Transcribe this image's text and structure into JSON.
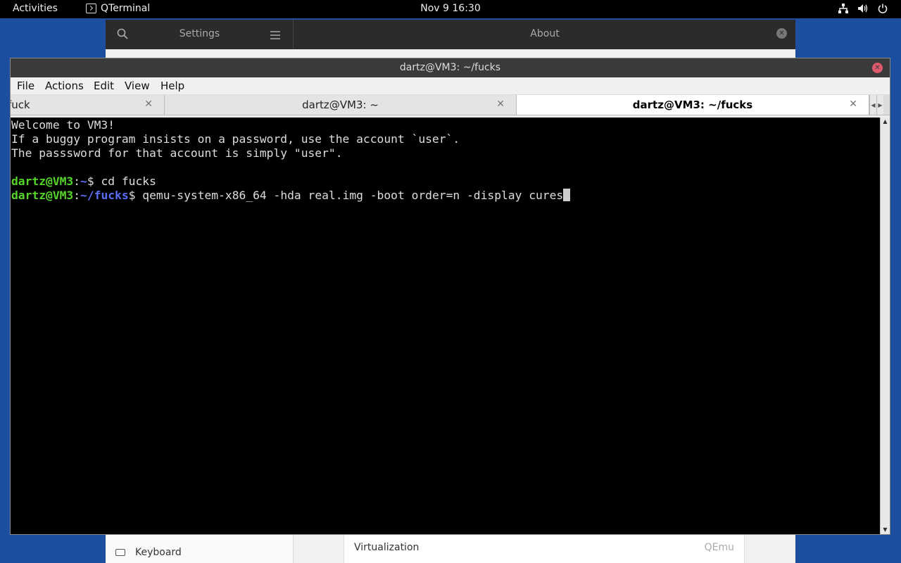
{
  "topbar": {
    "activities": "Activities",
    "app_name": "QTerminal",
    "clock": "Nov 9  16:30",
    "tray_icons": [
      "network-icon",
      "volume-icon",
      "power-icon"
    ]
  },
  "settings_window": {
    "title": "Settings",
    "panel_title": "About",
    "sidebar_item": "Keyboard",
    "row_label": "Virtualization",
    "row_value": "QEmu"
  },
  "qterminal": {
    "title": "dartz@VM3: ~/fucks",
    "menu": [
      "File",
      "Actions",
      "Edit",
      "View",
      "Help"
    ],
    "tabs": [
      {
        "label": "fuck",
        "active": false
      },
      {
        "label": "dartz@VM3: ~",
        "active": false
      },
      {
        "label": "dartz@VM3: ~/fucks",
        "active": true
      }
    ],
    "terminal": {
      "motd": [
        "Welcome to VM3!",
        "If a buggy program insists on a password, use the account `user`.",
        "The passsword for that account is simply \"user\"."
      ],
      "commands": [
        {
          "user": "dartz@VM3",
          "path": "~",
          "command": "cd fucks"
        },
        {
          "user": "dartz@VM3",
          "path": "~/fucks",
          "command": "qemu-system-x86_64 -hda real.img -boot order=n -display cures"
        }
      ]
    }
  },
  "colors": {
    "desktop": "#1c4fa0",
    "prompt_user": "#55d42a",
    "prompt_path": "#5b6cf5",
    "close_button": "#e05a6f"
  }
}
